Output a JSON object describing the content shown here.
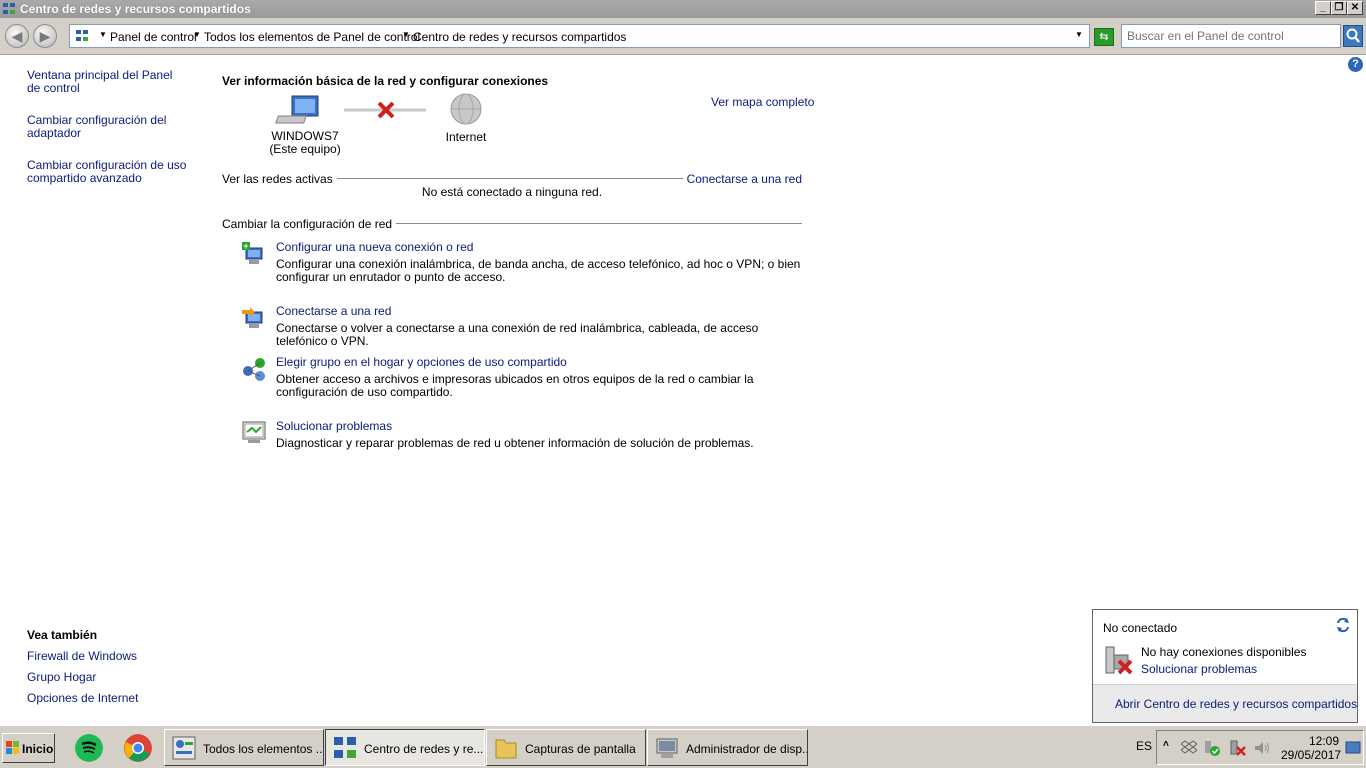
{
  "window": {
    "title": "Centro de redes y recursos compartidos",
    "controls": {
      "minimize": "_",
      "maximize": "❐",
      "close": "✕"
    }
  },
  "addressbar": {
    "crumbs": [
      "Panel de control",
      "Todos los elementos de Panel de control",
      "Centro de redes y recursos compartidos"
    ],
    "search_placeholder": "Buscar en el Panel de control"
  },
  "left_pane": {
    "links": [
      "Ventana principal del Panel de control",
      "Cambiar configuración del adaptador",
      "Cambiar configuración de uso compartido avanzado"
    ],
    "see_also_title": "Vea también",
    "see_also": [
      "Firewall de Windows",
      "Grupo Hogar",
      "Opciones de Internet"
    ]
  },
  "main": {
    "title": "Ver información básica de la red y configurar conexiones",
    "full_map_link": "Ver mapa completo",
    "computer_name": "WINDOWS7",
    "computer_sub": "(Este equipo)",
    "internet_label": "Internet",
    "active_networks_label": "Ver las redes activas",
    "connect_link": "Conectarse a una red",
    "no_connection": "No está conectado a ninguna red.",
    "change_settings_label": "Cambiar la configuración de red",
    "tasks": [
      {
        "icon": "new-connection-icon",
        "title": "Configurar una nueva conexión o red",
        "desc": "Configurar una conexión inalámbrica, de banda ancha, de acceso telefónico, ad hoc o VPN; o bien configurar un enrutador o punto de acceso."
      },
      {
        "icon": "connect-network-icon",
        "title": "Conectarse a una red",
        "desc": "Conectarse o volver a conectarse a una conexión de red inalámbrica, cableada, de acceso telefónico o VPN."
      },
      {
        "icon": "homegroup-icon",
        "title": "Elegir grupo en el hogar y opciones de uso compartido",
        "desc": "Obtener acceso a archivos e impresoras ubicados en otros equipos de la red o cambiar la configuración de uso compartido."
      },
      {
        "icon": "troubleshoot-icon",
        "title": "Solucionar problemas",
        "desc": "Diagnosticar y reparar problemas de red u obtener información de solución de problemas."
      }
    ]
  },
  "popup": {
    "status": "No conectado",
    "message": "No hay conexiones disponibles",
    "link": "Solucionar problemas",
    "footer_link": "Abrir Centro de redes y recursos compartidos"
  },
  "taskbar": {
    "start_label": "Inicio",
    "buttons": [
      "Todos los elementos ...",
      "Centro de redes y re...",
      "Capturas de pantalla",
      "Administrador de disp..."
    ],
    "language": "ES",
    "time": "12:09",
    "date": "29/05/2017"
  }
}
